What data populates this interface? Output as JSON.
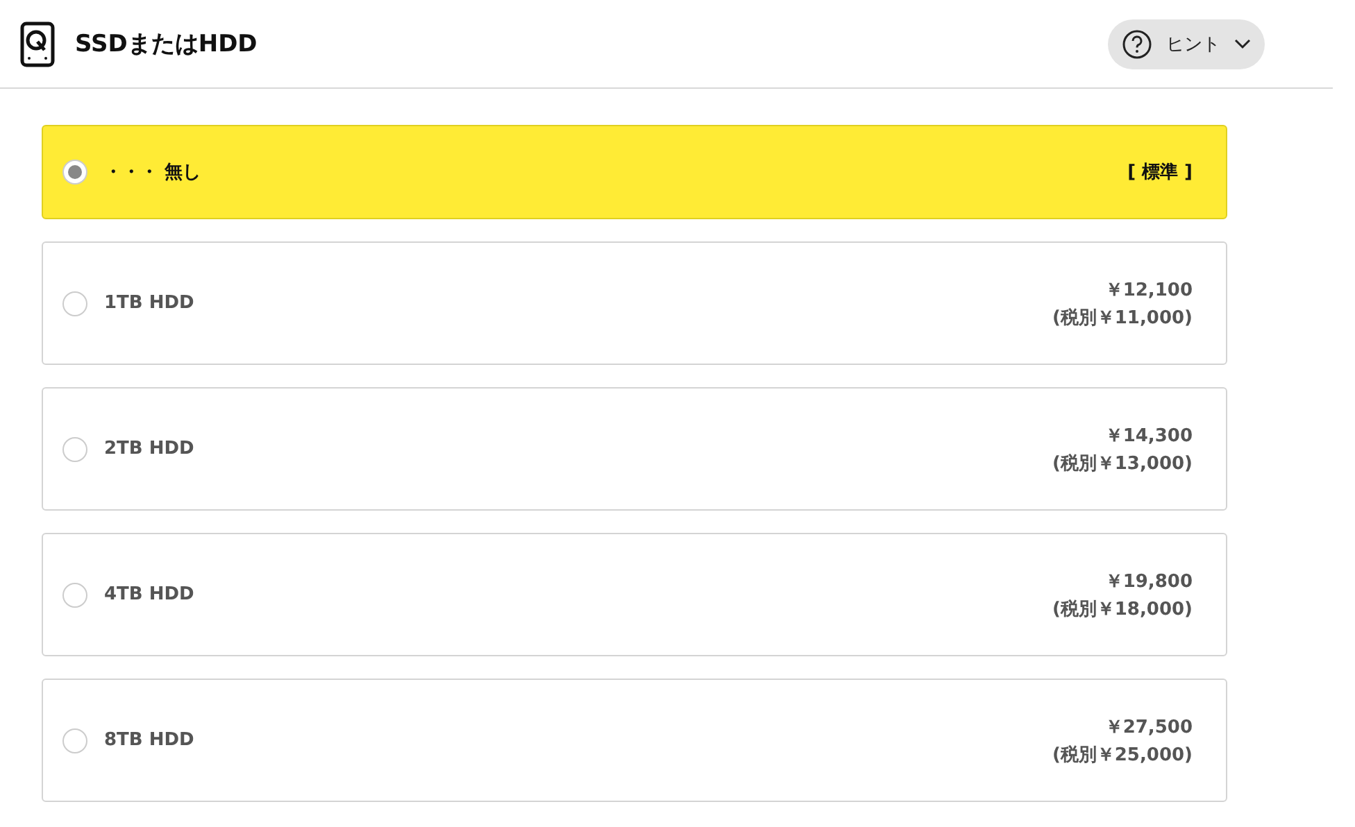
{
  "header": {
    "title": "SSDまたはHDD",
    "hint_button": {
      "label": "ヒント",
      "expanded": false
    }
  },
  "options": [
    {
      "kind": "standard",
      "label": "・・・ 無し",
      "note": "[ 標準 ]",
      "selected": true
    },
    {
      "kind": "priced",
      "label": "1TB HDD",
      "price": "￥12,100",
      "price_excl_tax": "(税別￥11,000)",
      "selected": false
    },
    {
      "kind": "priced",
      "label": "2TB HDD",
      "price": "￥14,300",
      "price_excl_tax": "(税別￥13,000)",
      "selected": false
    },
    {
      "kind": "priced",
      "label": "4TB HDD",
      "price": "￥19,800",
      "price_excl_tax": "(税別￥18,000)",
      "selected": false
    },
    {
      "kind": "priced",
      "label": "8TB HDD",
      "price": "￥27,500",
      "price_excl_tax": "(税別￥25,000)",
      "selected": false
    }
  ]
}
